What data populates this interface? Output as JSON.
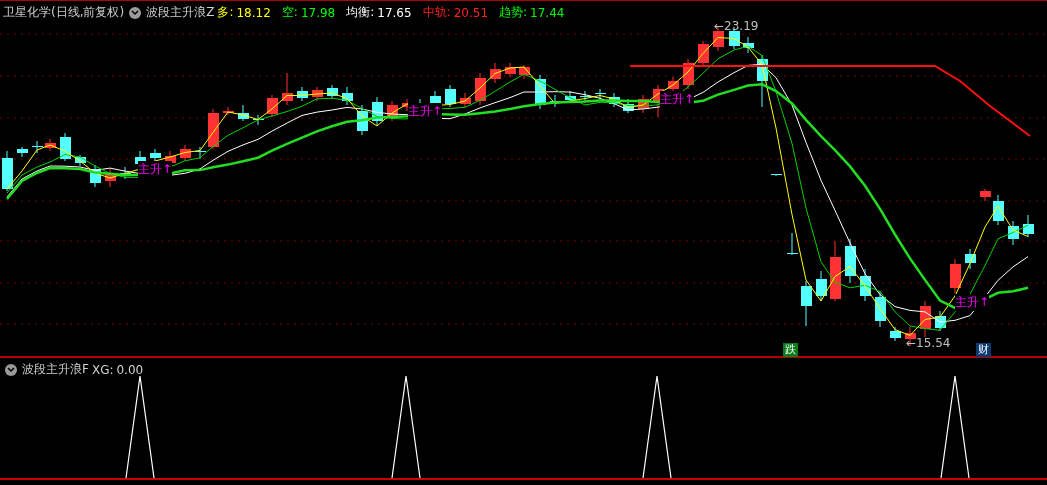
{
  "main_panel": {
    "title": "卫星化学(日线,前复权)",
    "indicator": "波段主升浪Z",
    "values": [
      {
        "label": "多:",
        "value": "18.12",
        "color": "#ffff00"
      },
      {
        "label": "空:",
        "value": "17.98",
        "color": "#00ff00"
      },
      {
        "label": "均衡:",
        "value": "17.65",
        "color": "#ffffff"
      },
      {
        "label": "中轨:",
        "value": "20.51",
        "color": "#ff2020"
      },
      {
        "label": "趋势:",
        "value": "17.44",
        "color": "#00ff00"
      }
    ],
    "signals": [
      "主升↑",
      "主升↑",
      "主升↑",
      "主升↑"
    ],
    "high_marker": "←23.19",
    "low_marker": "←15.54",
    "badges": [
      {
        "text": "跌",
        "color": "#0a7a1a"
      },
      {
        "text": "财",
        "color": "#0a3a70"
      }
    ]
  },
  "lower_panel": {
    "indicator": "波段主升浪F",
    "label": "XG:",
    "value": "0.00"
  }
}
